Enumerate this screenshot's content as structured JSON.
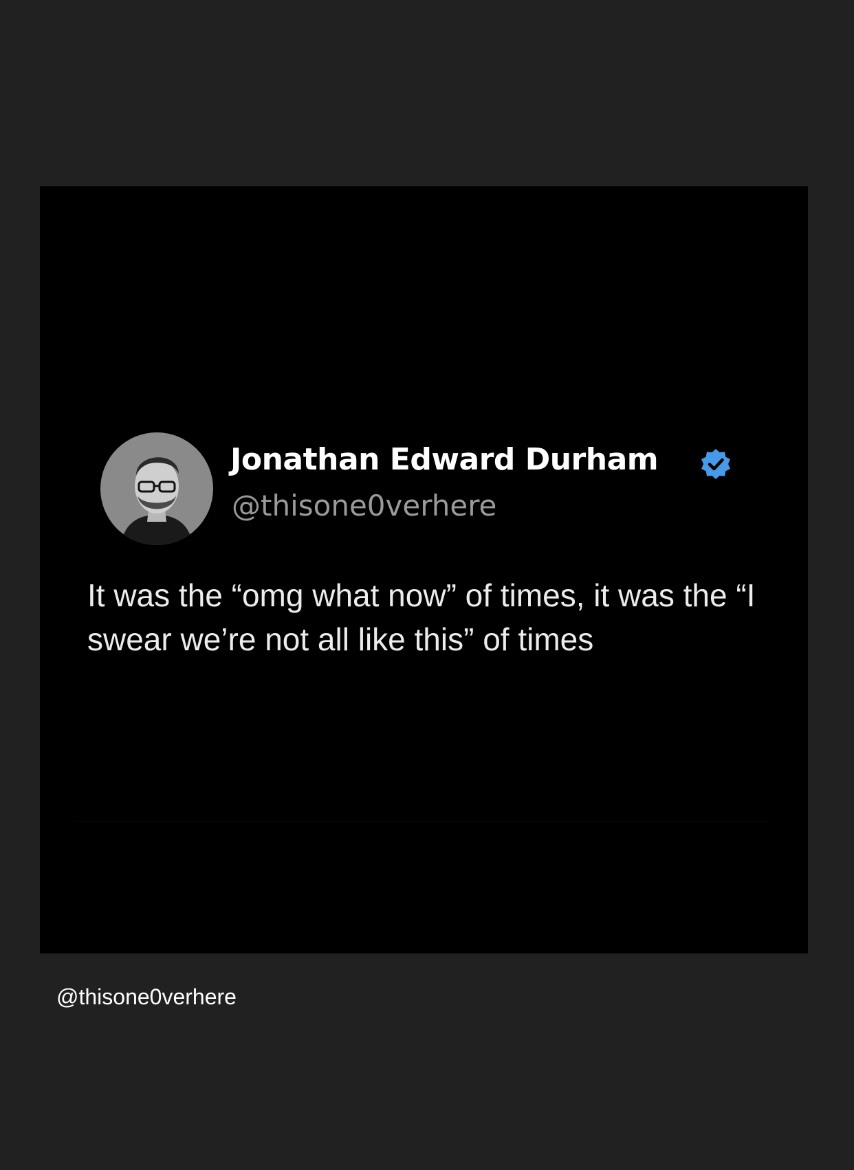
{
  "post": {
    "author_name": "Jonathan Edward Durham",
    "author_handle": "@thisone0verhere",
    "verified_icon": "verified-badge-icon",
    "verified_color": "#4a99e9",
    "text": "It was the “omg what now” of times, it was the “I swear we’re not all like this” of times"
  },
  "caption": {
    "text": "@thisone0verhere"
  },
  "colors": {
    "page_background": "#212121",
    "image_background": "#000000",
    "name_color": "#ffffff",
    "handle_color": "#9a9a9a",
    "text_color": "#ececec"
  }
}
